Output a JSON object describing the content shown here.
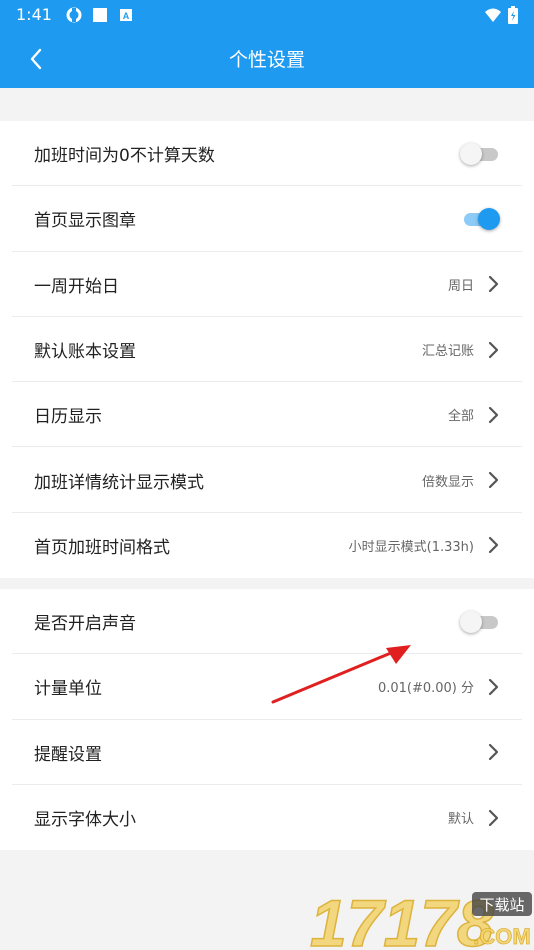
{
  "status_bar": {
    "time": "1:41"
  },
  "app_bar": {
    "title": "个性设置"
  },
  "group1": [
    {
      "label": "加班时间为0不计算天数",
      "type": "toggle",
      "on": false
    },
    {
      "label": "首页显示图章",
      "type": "toggle",
      "on": true
    },
    {
      "label": "一周开始日",
      "type": "nav",
      "value": "周日"
    },
    {
      "label": "默认账本设置",
      "type": "nav",
      "value": "汇总记账"
    },
    {
      "label": "日历显示",
      "type": "nav",
      "value": "全部"
    },
    {
      "label": "加班详情统计显示模式",
      "type": "nav",
      "value": "倍数显示"
    },
    {
      "label": "首页加班时间格式",
      "type": "nav",
      "value": "小时显示模式(1.33h)"
    }
  ],
  "group2": [
    {
      "label": "是否开启声音",
      "type": "toggle",
      "on": false
    },
    {
      "label": "计量单位",
      "type": "nav",
      "value": "0.01(#0.00) 分"
    },
    {
      "label": "提醒设置",
      "type": "nav",
      "value": ""
    },
    {
      "label": "显示字体大小",
      "type": "nav",
      "value": "默认"
    }
  ],
  "colors": {
    "primary": "#1e9bf0",
    "annotation_arrow": "#e02020"
  },
  "watermark": {
    "digits": "17178",
    "tag": "下载站",
    "suffix": ".COM"
  }
}
